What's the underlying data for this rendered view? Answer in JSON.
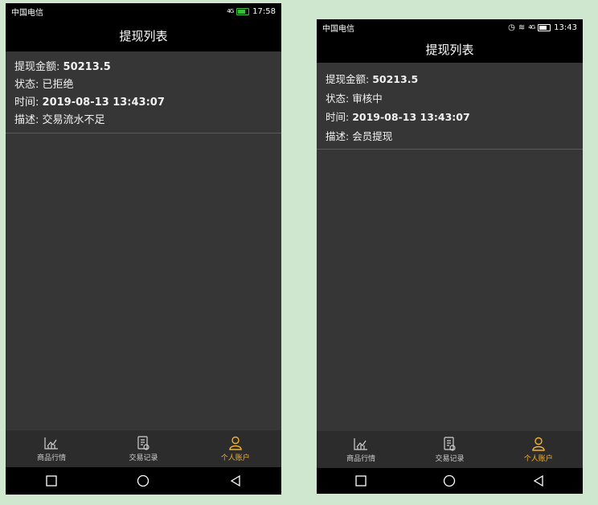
{
  "left": {
    "status": {
      "carrier": "中国电信",
      "signal": "4G",
      "time": "17:58"
    },
    "title": "提现列表",
    "record": {
      "amount_label": "提现金额:",
      "amount": "50213.5",
      "status_label": "状态:",
      "status": "已拒绝",
      "time_label": "时间:",
      "time": "2019-08-13 13:43:07",
      "desc_label": "描述:",
      "desc": "交易流水不足"
    },
    "tabs": [
      {
        "label": "商品行情",
        "icon": "chart-icon"
      },
      {
        "label": "交易记录",
        "icon": "records-icon"
      },
      {
        "label": "个人账户",
        "icon": "user-icon",
        "active": true
      }
    ]
  },
  "right": {
    "status": {
      "carrier": "中国电信",
      "signal": "4G",
      "time": "13:43"
    },
    "title": "提现列表",
    "record": {
      "amount_label": "提现金额:",
      "amount": "50213.5",
      "status_label": "状态:",
      "status": "审核中",
      "time_label": "时间:",
      "time": "2019-08-13 13:43:07",
      "desc_label": "描述:",
      "desc": "会员提现"
    },
    "tabs": [
      {
        "label": "商品行情",
        "icon": "chart-icon"
      },
      {
        "label": "交易记录",
        "icon": "records-icon"
      },
      {
        "label": "个人账户",
        "icon": "user-icon",
        "active": true
      }
    ]
  },
  "colors": {
    "accent": "#f2b22e",
    "background": "#363636",
    "tabbar": "#2c2c2c"
  }
}
